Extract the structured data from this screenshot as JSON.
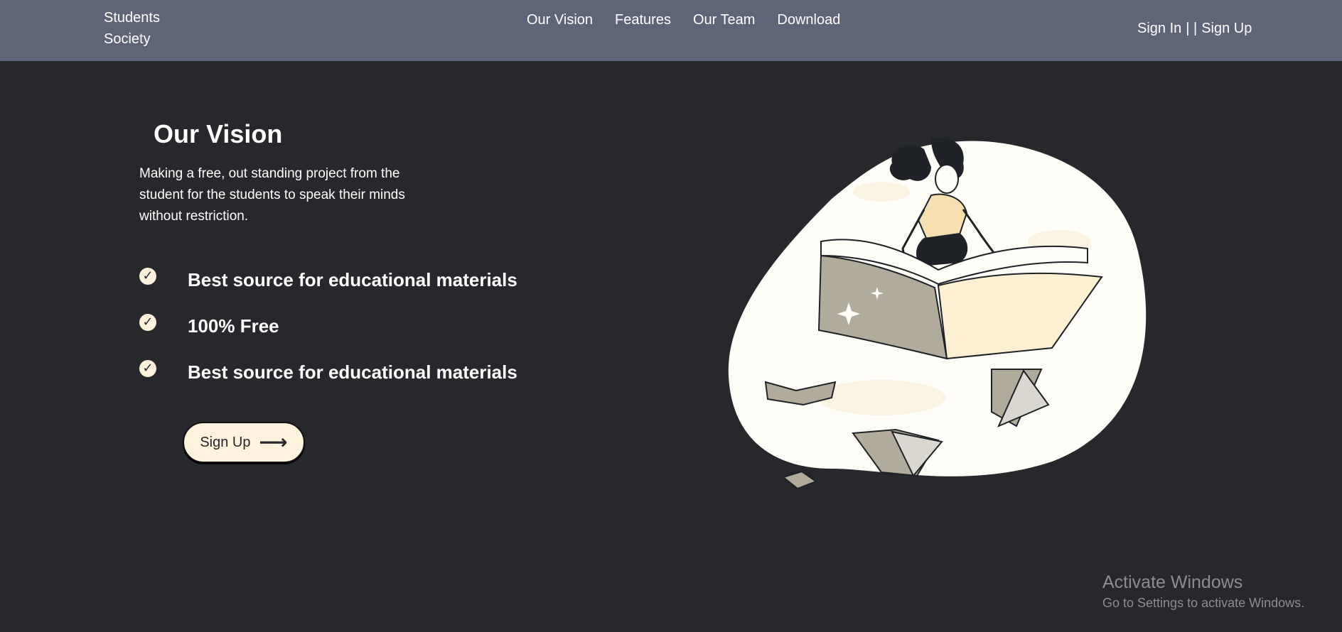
{
  "navbar": {
    "brand_line1": "Students",
    "brand_line2": "Society",
    "links": [
      "Our Vision",
      "Features",
      "Our Team",
      "Download"
    ],
    "sign_in": "Sign In",
    "separator": "| |",
    "sign_up": "Sign Up"
  },
  "hero": {
    "title": "Our Vision",
    "description": "Making a free, out standing project from the student for the students to speak their minds without restriction.",
    "features": [
      "Best source for educational materials",
      "100% Free",
      "Best source for educational materials"
    ],
    "cta_label": "Sign Up",
    "cta_icon": "right-arrow-icon"
  },
  "illustration": {
    "subject": "woman-riding-open-book-icon"
  },
  "watermark": {
    "title": "Activate Windows",
    "subtitle": "Go to Settings to activate Windows."
  },
  "colors": {
    "navbar": "#5f6578",
    "background": "#27282b",
    "accent_cream": "#fdf3dc",
    "blob": "#fefdf8"
  }
}
